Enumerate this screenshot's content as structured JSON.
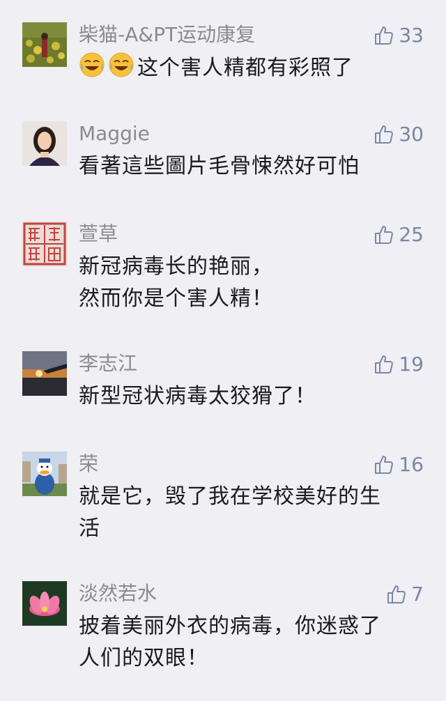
{
  "comments": [
    {
      "name": "柴猫-A&PT运动康复",
      "likes": "33",
      "text": "这个害人精都有彩照了",
      "avatar_icon": "field-flowers-avatar-icon",
      "emoji": [
        "crying-laughing-emoji-icon",
        "crying-laughing-emoji-icon"
      ]
    },
    {
      "name": "Maggie",
      "likes": "30",
      "text": "看著這些圖片毛骨悚然好可怕",
      "avatar_icon": "woman-portrait-avatar-icon"
    },
    {
      "name": "萱草",
      "likes": "25",
      "text_lines": [
        "新冠病毒长的艳丽，",
        "然而你是个害人精！"
      ],
      "avatar_icon": "red-seal-avatar-icon"
    },
    {
      "name": "李志江",
      "likes": "19",
      "text": "新型冠状病毒太狡猾了！",
      "avatar_icon": "airplane-sunset-avatar-icon"
    },
    {
      "name": "荣",
      "likes": "16",
      "text_lines": [
        "就是它，毁了我在学校美好的生",
        "活"
      ],
      "avatar_icon": "donald-duck-avatar-icon"
    },
    {
      "name": "淡然若水",
      "likes": "7",
      "text_lines": [
        "披着美丽外衣的病毒，你迷惑了",
        "人们的双眼！"
      ],
      "avatar_icon": "lotus-flower-avatar-icon"
    }
  ],
  "colors": {
    "background": "#efeff4",
    "name": "#8a8a8f",
    "text": "#1a1a1a",
    "like": "#7a86a3"
  }
}
